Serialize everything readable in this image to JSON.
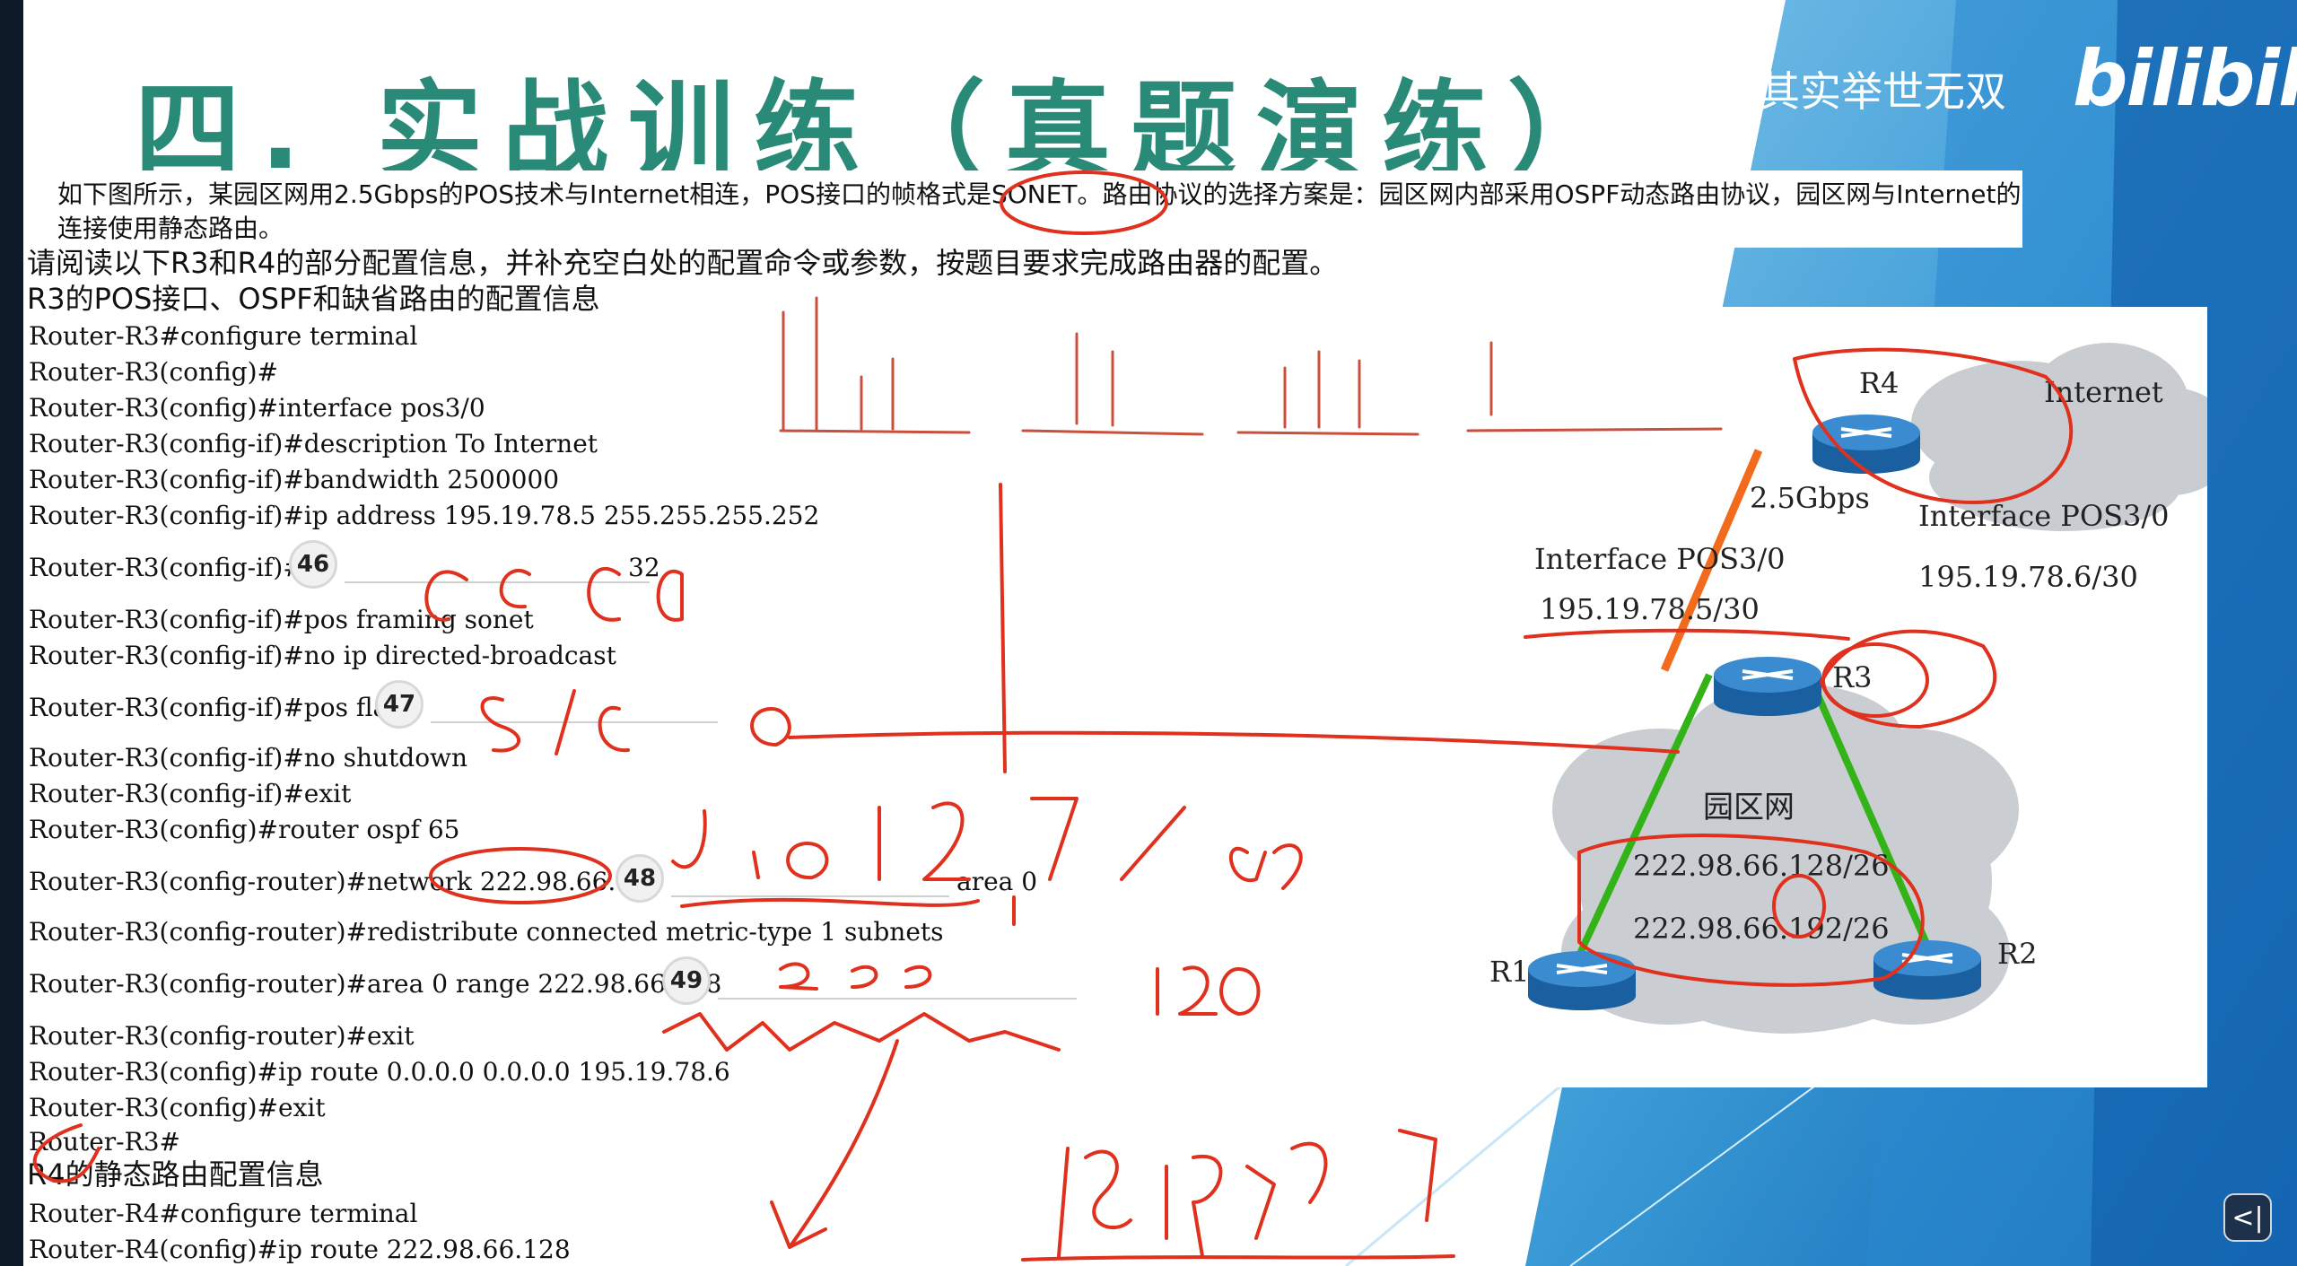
{
  "slide": {
    "title": "四. 实战训练（真题演练）",
    "watermark_text": "其实举世无双",
    "watermark_logo": "bilibili",
    "intro": "如下图所示，某园区网用2.5Gbps的POS技术与Internet相连，POS接口的帧格式是SONET。路由协议的选择方案是：园区网内部采用OSPF动态路由协议，园区网与Internet的连接使用静态路由。",
    "instruction": "请阅读以下R3和R4的部分配置信息，并补充空白处的配置命令或参数，按题目要求完成路由器的配置。",
    "r3_heading": "R3的POS接口、OSPF和缺省路由的配置信息",
    "r3_lines": [
      "Router-R3#configure terminal",
      "Router-R3(config)#",
      "Router-R3(config)#interface pos3/0",
      "Router-R3(config-if)#description To Internet",
      "Router-R3(config-if)#bandwidth 2500000",
      "Router-R3(config-if)#ip address 195.19.78.5 255.255.255.252"
    ],
    "blank46": {
      "prefix": "Router-R3(config-if)#",
      "number": "46",
      "suffix": "32"
    },
    "r3_lines2": [
      "Router-R3(config-if)#pos framing sonet",
      "Router-R3(config-if)#no ip directed-broadcast"
    ],
    "blank47": {
      "prefix": "Router-R3(config-if)#pos flag",
      "number": "47"
    },
    "r3_lines3": [
      "Router-R3(config-if)#no shutdown",
      "Router-R3(config-if)#exit",
      "Router-R3(config)#router ospf 65"
    ],
    "blank48": {
      "prefix": "Router-R3(config-router)#network 222.98.66.128",
      "number": "48",
      "suffix": "area 0"
    },
    "redistribute": "Router-R3(config-router)#redistribute connected metric-type 1 subnets",
    "blank49": {
      "prefix": "Router-R3(config-router)#area 0 range 222.98.66.128",
      "number": "49"
    },
    "r3_lines4": [
      "Router-R3(config-router)#exit",
      "Router-R3(config)#ip route 0.0.0.0 0.0.0.0 195.19.78.6",
      "Router-R3(config)#exit",
      "Router-R3#"
    ],
    "r4_heading": "R4的静态路由配置信息",
    "r4_lines": [
      "Router-R4#configure terminal",
      "Router-R4(config)#ip route 222.98.66.128"
    ]
  },
  "diagram": {
    "r4": "R4",
    "internet": "Internet",
    "speed": "2.5Gbps",
    "r4_iface": "Interface POS3/0",
    "r4_ip": "195.19.78.6/30",
    "r3_iface": "Interface POS3/0",
    "r3_ip": "195.19.78.5/30",
    "r3": "R3",
    "campus": "园区网",
    "net1": "222.98.66.128/26",
    "net2": "222.98.66.192/26",
    "r1": "R1",
    "r2": "R2"
  },
  "handwriting": {
    "ans46": "crc 0",
    "ans47": "s1 s0  0",
    "ans48": "0.0.0.127",
    "mask": "/25",
    "ans49": "255. . 128",
    "r4_gateway": "195.19.78"
  },
  "colors": {
    "title": "#2a8a78",
    "ink": "#e0301e",
    "link_green": "#33b318",
    "link_orange": "#f26a1b",
    "router_blue": "#1f6fb8"
  },
  "controls": {
    "back_icon": "back-arrow-icon",
    "back_glyph": "<|"
  }
}
